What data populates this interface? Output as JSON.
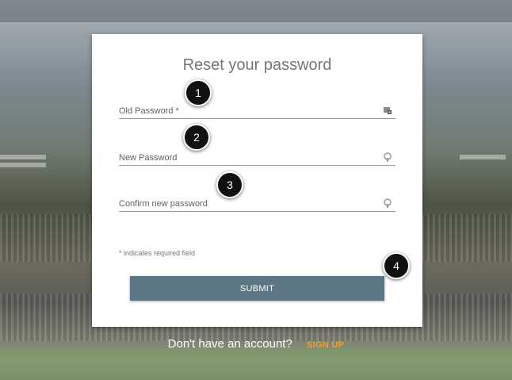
{
  "form": {
    "title": "Reset your password",
    "fields": [
      {
        "label": "Old Password *",
        "icon": "password-manager-icon"
      },
      {
        "label": "New Password",
        "icon": "key-icon"
      },
      {
        "label": "Confirm new password",
        "icon": "key-icon"
      }
    ],
    "required_note": "* indicates required field",
    "submit_label": "SUBMIT"
  },
  "footer": {
    "prompt": "Don't have an account?",
    "signup_label": "SIGN UP"
  },
  "callouts": [
    "1",
    "2",
    "3",
    "4"
  ],
  "colors": {
    "submit_bg": "#5d7683",
    "signup_link": "#f2a024",
    "callout_bg": "#111111"
  }
}
